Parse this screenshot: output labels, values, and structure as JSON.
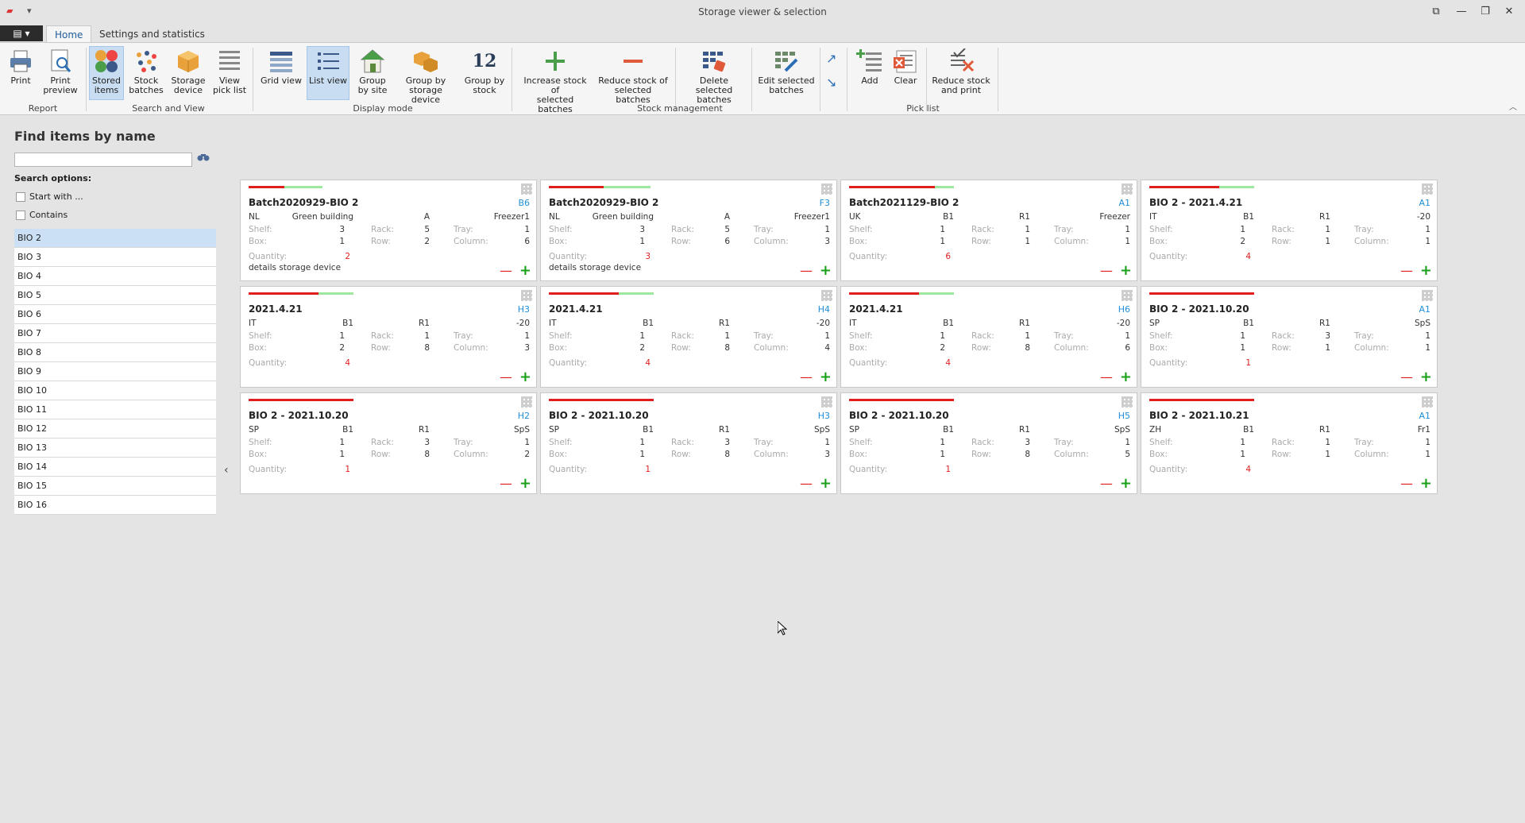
{
  "window": {
    "title": "Storage viewer & selection",
    "controls": [
      "⧉",
      "—",
      "❐",
      "✕"
    ]
  },
  "tabs": {
    "file": "▤ ▾",
    "items": [
      "Home",
      "Settings and statistics"
    ]
  },
  "ribbon": {
    "groups": [
      {
        "label": "Report"
      },
      {
        "label": "Search and View"
      },
      {
        "label": "Display mode"
      },
      {
        "label": "Stock management"
      },
      {
        "label": "Pick list"
      }
    ],
    "buttons": {
      "print": "Print",
      "print_preview": "Print\npreview",
      "stored_items": "Stored\nitems",
      "stock_batches": "Stock\nbatches",
      "storage_device": "Storage\ndevice",
      "view_pick_list": "View\npick list",
      "grid_view": "Grid view",
      "list_view": "List view",
      "group_by_site": "Group\nby site",
      "group_by_storage_device": "Group by\nstorage device",
      "group_by_stock": "Group by\nstock",
      "group_by_stock_icon_text": "12",
      "increase_stock": "Increase stock of\nselected batches",
      "reduce_stock": "Reduce stock of\nselected batches",
      "delete_batches": "Delete selected\nbatches",
      "edit_batches": "Edit selected\nbatches",
      "add": "Add",
      "clear": "Clear",
      "reduce_stock_print": "Reduce stock\nand print"
    }
  },
  "left": {
    "title": "Find items by name",
    "search_value": "",
    "search_options_label": "Search options:",
    "opt_start": "Start with ...",
    "opt_contains": "Contains",
    "items": [
      "BIO 2",
      "BIO 3",
      "BIO 4",
      "BIO 5",
      "BIO 6",
      "BIO 7",
      "BIO 8",
      "BIO 9",
      "BIO 10",
      "BIO 11",
      "BIO 12",
      "BIO 13",
      "BIO 14",
      "BIO 15",
      "BIO 16"
    ],
    "selected_index": 0
  },
  "labels": {
    "shelf": "Shelf:",
    "box": "Box:",
    "rack": "Rack:",
    "row": "Row:",
    "tray": "Tray:",
    "column": "Column:",
    "quantity": "Quantity:"
  },
  "cards": [
    {
      "title": "Batch2020929-BIO 2",
      "loc": "B6",
      "country": "NL",
      "site": "Green building",
      "device": "A",
      "storage": "Freezer1",
      "shelf": "3",
      "box": "1",
      "rack": "5",
      "row": "2",
      "tray": "1",
      "column": "6",
      "quantity": "2",
      "details": "details storage device",
      "red": 0.34,
      "green": 0.7
    },
    {
      "title": "Batch2020929-BIO 2",
      "loc": "F3",
      "country": "NL",
      "site": "Green building",
      "device": "A",
      "storage": "Freezer1",
      "shelf": "3",
      "box": "1",
      "rack": "5",
      "row": "6",
      "tray": "1",
      "column": "3",
      "quantity": "3",
      "details": "details storage device",
      "red": 0.52,
      "green": 0.97
    },
    {
      "title": "Batch2021129-BIO 2",
      "loc": "A1",
      "country": "UK",
      "site": "B1",
      "device": "R1",
      "storage": "Freezer",
      "shelf": "1",
      "box": "1",
      "rack": "1",
      "row": "1",
      "tray": "1",
      "column": "1",
      "quantity": "6",
      "details": "",
      "red": 0.82,
      "green": 1.0
    },
    {
      "title": "BIO 2 - 2021.4.21",
      "loc": "A1",
      "country": "IT",
      "site": "B1",
      "device": "R1",
      "storage": "-20",
      "shelf": "1",
      "box": "2",
      "rack": "1",
      "row": "1",
      "tray": "1",
      "column": "1",
      "quantity": "4",
      "details": "",
      "red": 0.67,
      "green": 1.0
    },
    {
      "title": "2021.4.21",
      "loc": "H3",
      "country": "IT",
      "site": "B1",
      "device": "R1",
      "storage": "-20",
      "shelf": "1",
      "box": "2",
      "rack": "1",
      "row": "8",
      "tray": "1",
      "column": "3",
      "quantity": "4",
      "details": "",
      "red": 0.67,
      "green": 1.0
    },
    {
      "title": "2021.4.21",
      "loc": "H4",
      "country": "IT",
      "site": "B1",
      "device": "R1",
      "storage": "-20",
      "shelf": "1",
      "box": "2",
      "rack": "1",
      "row": "8",
      "tray": "1",
      "column": "4",
      "quantity": "4",
      "details": "",
      "red": 0.67,
      "green": 1.0
    },
    {
      "title": "2021.4.21",
      "loc": "H6",
      "country": "IT",
      "site": "B1",
      "device": "R1",
      "storage": "-20",
      "shelf": "1",
      "box": "2",
      "rack": "1",
      "row": "8",
      "tray": "1",
      "column": "6",
      "quantity": "4",
      "details": "",
      "red": 0.67,
      "green": 1.0
    },
    {
      "title": "BIO 2 - 2021.10.20",
      "loc": "A1",
      "country": "SP",
      "site": "B1",
      "device": "R1",
      "storage": "SpS",
      "shelf": "1",
      "box": "1",
      "rack": "3",
      "row": "1",
      "tray": "1",
      "column": "1",
      "quantity": "1",
      "details": "",
      "red": 1.0,
      "green": 1.0
    },
    {
      "title": "BIO 2 - 2021.10.20",
      "loc": "H2",
      "country": "SP",
      "site": "B1",
      "device": "R1",
      "storage": "SpS",
      "shelf": "1",
      "box": "1",
      "rack": "3",
      "row": "8",
      "tray": "1",
      "column": "2",
      "quantity": "1",
      "details": "",
      "red": 1.0,
      "green": 1.0
    },
    {
      "title": "BIO 2 - 2021.10.20",
      "loc": "H3",
      "country": "SP",
      "site": "B1",
      "device": "R1",
      "storage": "SpS",
      "shelf": "1",
      "box": "1",
      "rack": "3",
      "row": "8",
      "tray": "1",
      "column": "3",
      "quantity": "1",
      "details": "",
      "red": 1.0,
      "green": 1.0
    },
    {
      "title": "BIO 2 - 2021.10.20",
      "loc": "H5",
      "country": "SP",
      "site": "B1",
      "device": "R1",
      "storage": "SpS",
      "shelf": "1",
      "box": "1",
      "rack": "3",
      "row": "8",
      "tray": "1",
      "column": "5",
      "quantity": "1",
      "details": "",
      "red": 1.0,
      "green": 1.0
    },
    {
      "title": "BIO 2 - 2021.10.21",
      "loc": "A1",
      "country": "ZH",
      "site": "B1",
      "device": "R1",
      "storage": "Fr1",
      "shelf": "1",
      "box": "1",
      "rack": "1",
      "row": "1",
      "tray": "1",
      "column": "1",
      "quantity": "4",
      "details": "",
      "red": 1.0,
      "green": 1.0
    }
  ],
  "colors": {
    "accent": "#1e8fd8",
    "quantity": "#e01e1e",
    "fill_red": "#e01e1e",
    "fill_green": "#9ee79e",
    "minus": "#e01e1e",
    "plus": "#18a018",
    "selected": "#c8ddf1"
  }
}
